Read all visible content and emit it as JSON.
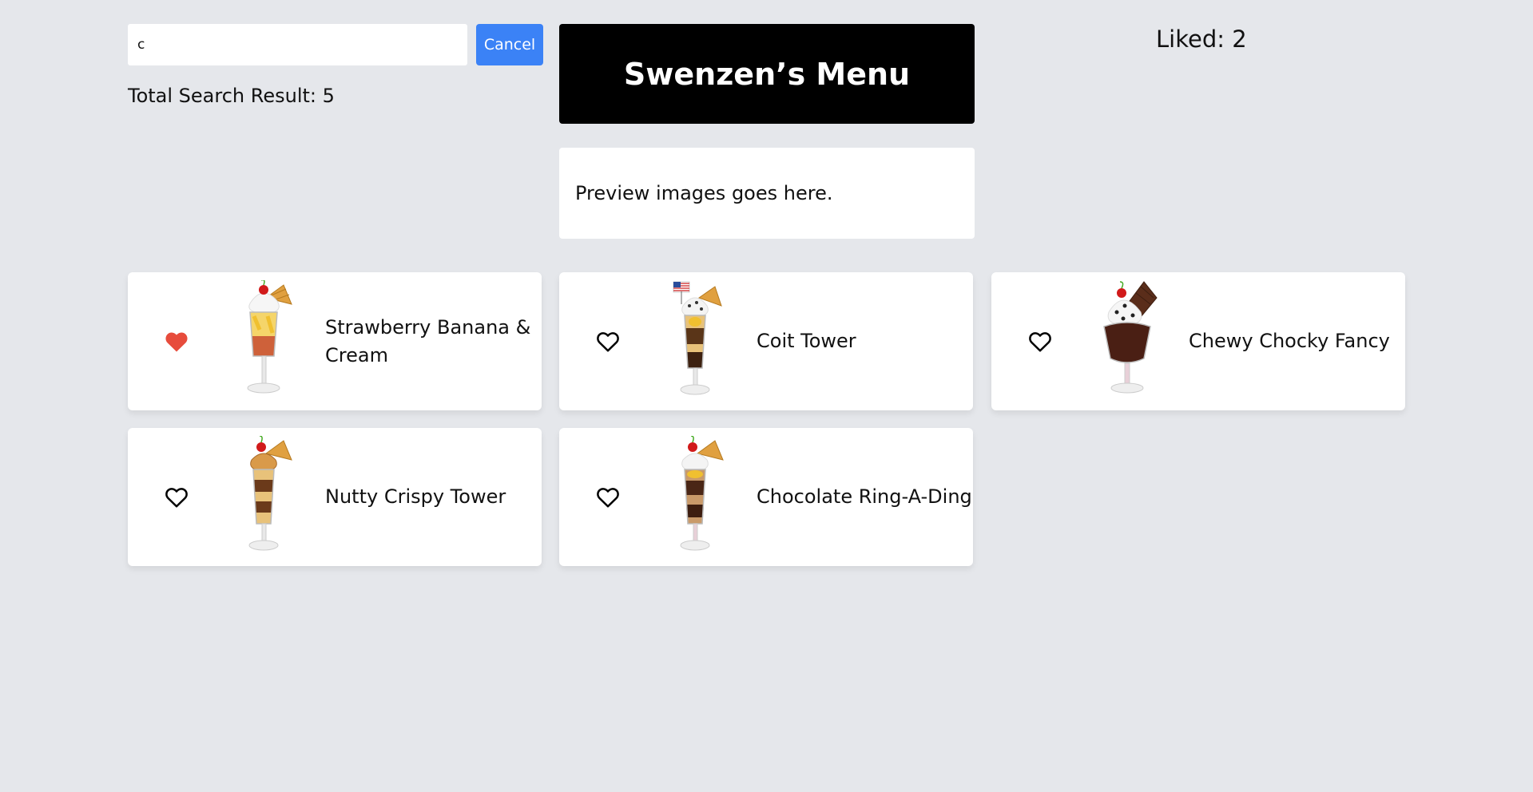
{
  "search": {
    "value": "c",
    "placeholder": ""
  },
  "cancel_label": "Cancel",
  "result_count": "Total Search Result: 5",
  "title": "Swenzen’s Menu",
  "liked_count": "Liked: 2",
  "preview_text": "Preview images goes here.",
  "colors": {
    "page_bg": "#e5e7eb",
    "accent_blue": "#3b82f6",
    "liked_red": "#e74c3c",
    "title_bg": "#000000"
  },
  "items": [
    {
      "name": "Strawberry Banana & Cream",
      "liked": true,
      "heart_icon": "heart-filled-icon"
    },
    {
      "name": "Coit Tower",
      "liked": false,
      "heart_icon": "heart-outline-icon"
    },
    {
      "name": "Chewy Chocky Fancy",
      "liked": false,
      "heart_icon": "heart-outline-icon"
    },
    {
      "name": "Nutty Crispy Tower",
      "liked": false,
      "heart_icon": "heart-outline-icon"
    },
    {
      "name": "Chocolate Ring-A-Ding",
      "liked": false,
      "heart_icon": "heart-outline-icon"
    }
  ]
}
